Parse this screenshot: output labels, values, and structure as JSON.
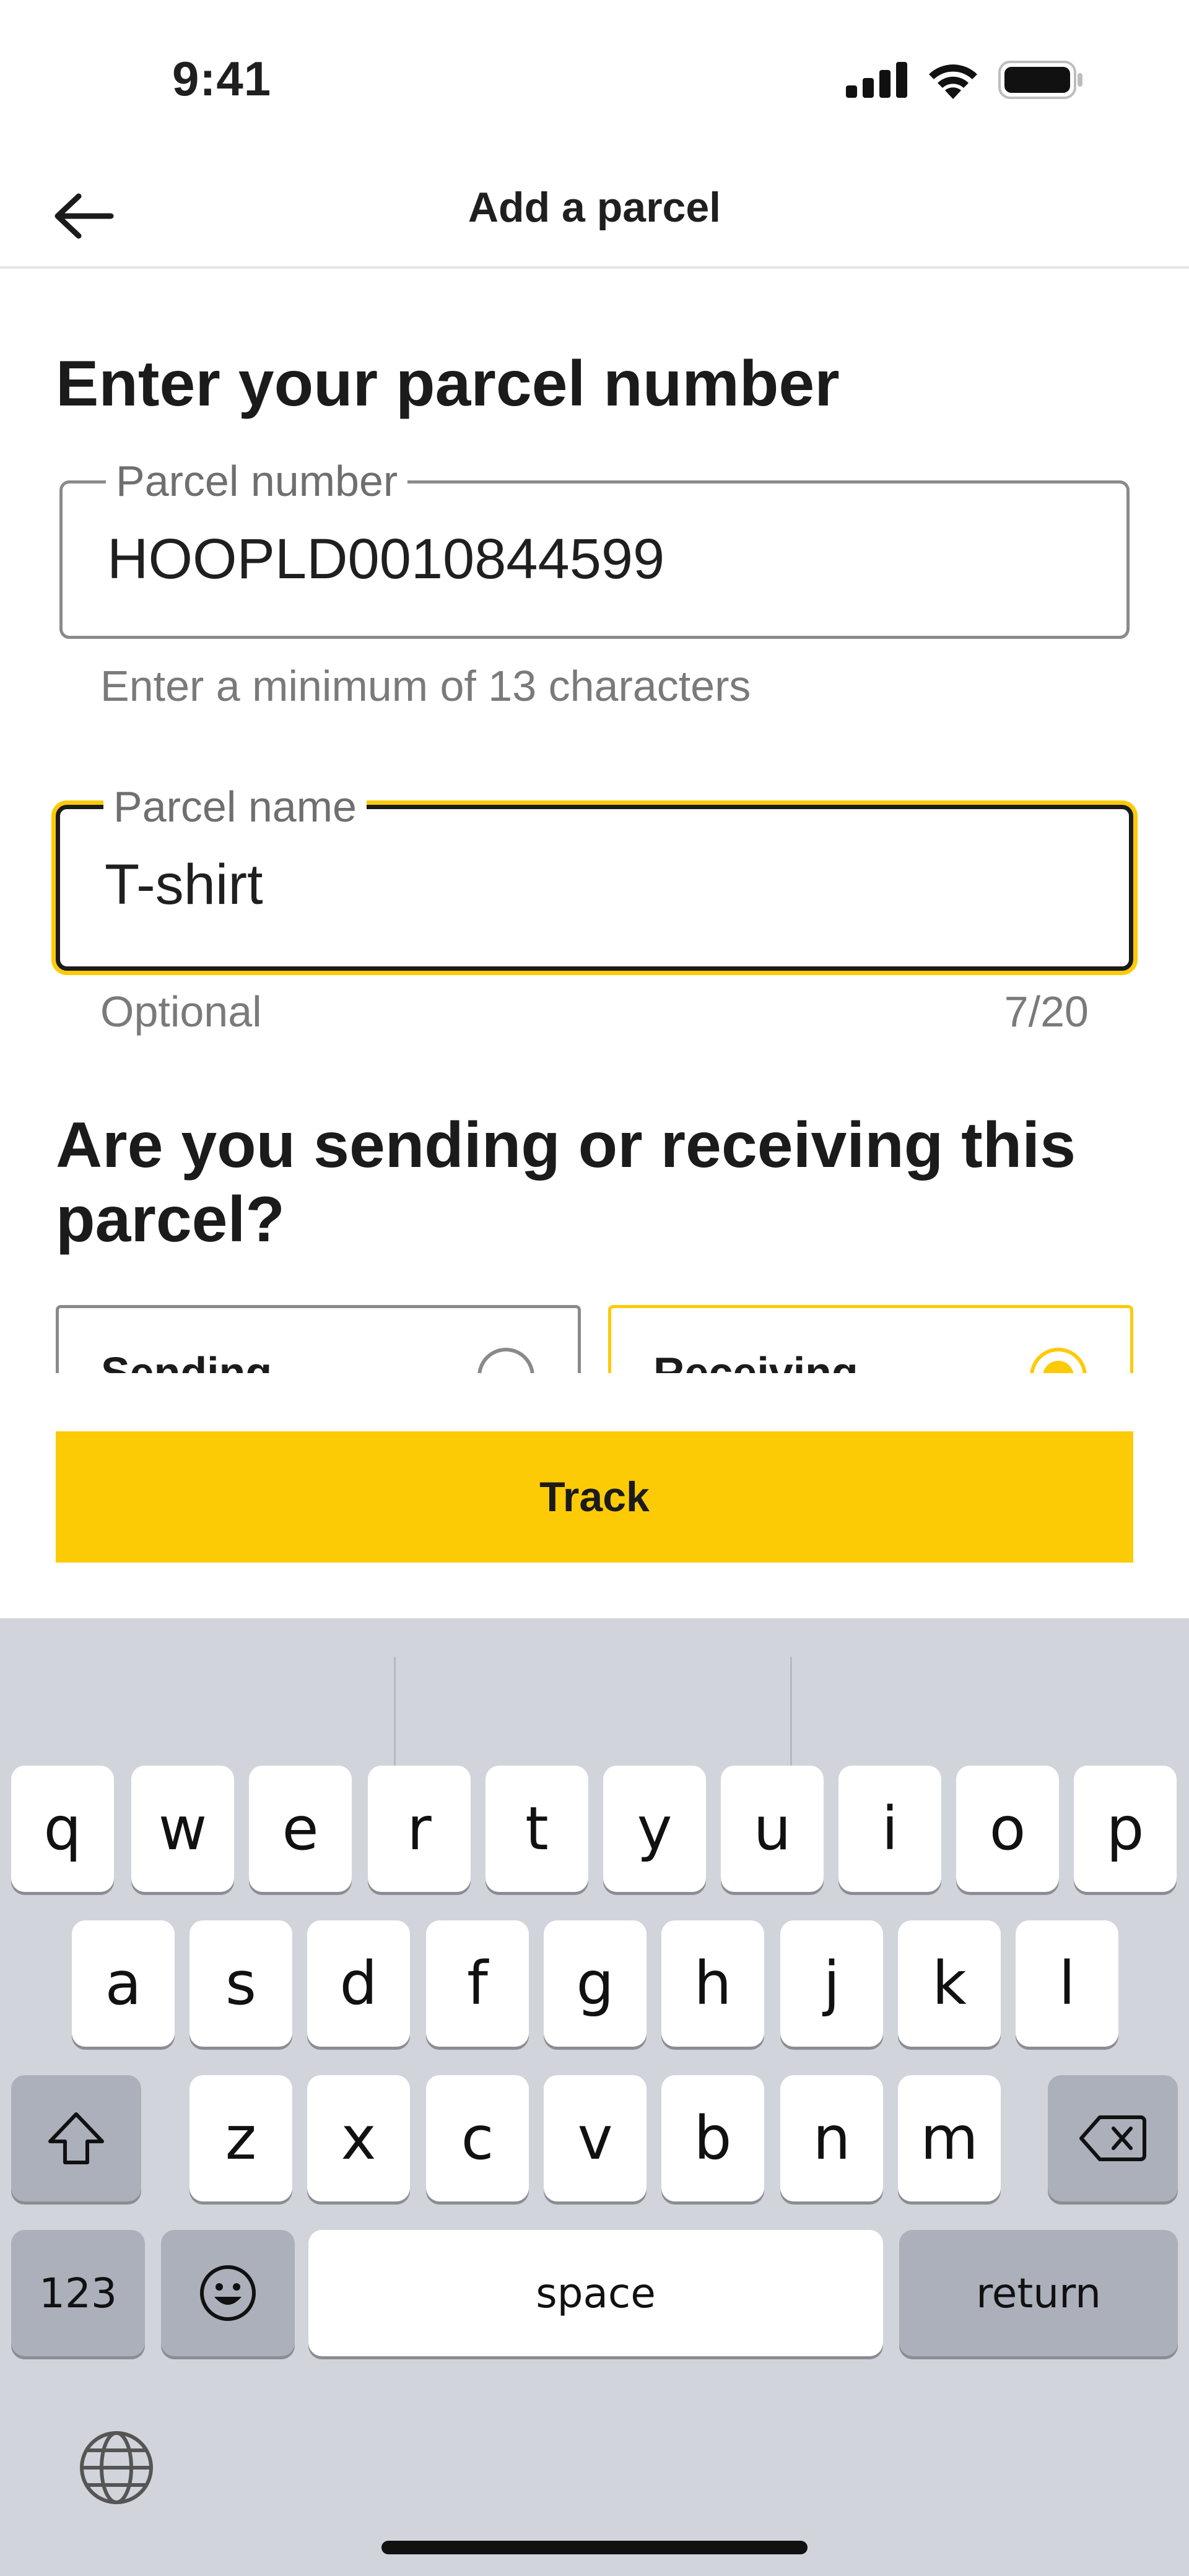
{
  "status_bar": {
    "time": "9:41"
  },
  "header": {
    "title": "Add a parcel"
  },
  "form": {
    "heading": "Enter your parcel number",
    "parcel_number": {
      "label": "Parcel number",
      "value": "HOOPLD0010844599",
      "helper": "Enter a minimum of 13 characters"
    },
    "parcel_name": {
      "label": "Parcel name",
      "value": "T-shirt",
      "helper": "Optional",
      "counter": "7/20"
    },
    "direction_heading_line1": "Are you sending or receiving this",
    "direction_heading_line2": "parcel?",
    "options": [
      {
        "label": "Sending",
        "selected": false
      },
      {
        "label": "Receiving",
        "selected": true
      }
    ],
    "submit_label": "Track"
  },
  "keyboard": {
    "row1": [
      "q",
      "w",
      "e",
      "r",
      "t",
      "y",
      "u",
      "i",
      "o",
      "p"
    ],
    "row2": [
      "a",
      "s",
      "d",
      "f",
      "g",
      "h",
      "j",
      "k",
      "l"
    ],
    "row3": [
      "z",
      "x",
      "c",
      "v",
      "b",
      "n",
      "m"
    ],
    "numbers_label": "123",
    "space_label": "space",
    "return_label": "return"
  },
  "colors": {
    "accent": "#fccb06",
    "keyboard_bg": "#d1d4db",
    "text": "#1b1b1b"
  }
}
